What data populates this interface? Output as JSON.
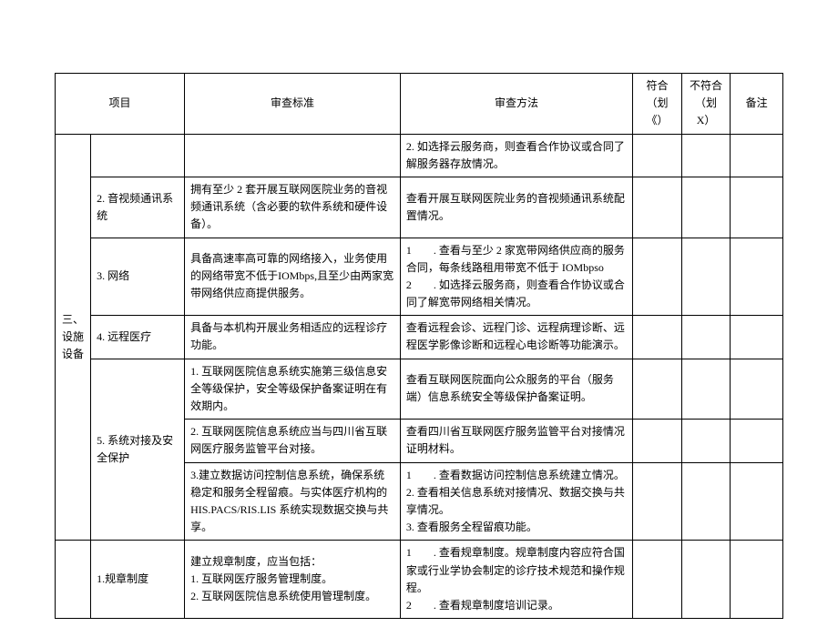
{
  "header": {
    "project": "项目",
    "standard": "审查标准",
    "method": "审查方法",
    "fit": "符合（划《）",
    "nofit": "不符合（划 X）",
    "note": "备注"
  },
  "section": {
    "title": "三、设施设备"
  },
  "rows": [
    {
      "item": "",
      "standard": "",
      "method": "2. 如选择云服务商，则查看合作协议或合同了解服务器存放情况。"
    },
    {
      "item": "2. 音视频通讯系统",
      "standard": "拥有至少 2 套开展互联网医院业务的音视频通讯系统（含必要的软件系统和硬件设备）。",
      "method": "查看开展互联网医院业务的音视频通讯系统配置情况。"
    },
    {
      "item": "3. 网络",
      "standard": "具备高速率高可靠的网络接入，业务使用的网络带宽不低于IOMbps,且至少由两家宽带网络供应商提供服务。",
      "method": "1　　. 查看与至少 2 家宽带网络供应商的服务合同，每条线路租用带宽不低于 IOMbpso\n2　　. 如选择云服务商，则查看合作协议或合同了解宽带网络相关情况。"
    },
    {
      "item": "4. 远程医疗",
      "standard": "具备与本机构开展业务相适应的远程诊疗功能。",
      "method": "查看远程会诊、远程门诊、远程病理诊断、远程医学影像诊断和远程心电诊断等功能演示。"
    },
    {
      "item": "5. 系统对接及安全保护",
      "subrows": [
        {
          "standard": "1. 互联网医院信息系统实施第三级信息安全等级保护，安全等级保护备案证明在有效期内。",
          "method": "查看互联网医院面向公众服务的平台（服务端）信息系统安全等级保护备案证明。"
        },
        {
          "standard": "2. 互联网医院信息系统应当与四川省互联网医疗服务监管平台对接。",
          "method": "查看四川省互联网医疗服务监管平台对接情况证明材料。"
        },
        {
          "standard": "3.建立数据访问控制信息系统，确保系统稳定和服务全程留痕。与实体医疗机构的 HIS.PACS/RIS.LIS 系统实现数据交换与共享。",
          "method": "1　　. 查看数据访问控制信息系统建立情况。\n2. 查看相关信息系统对接情况、数据交换与共享情况。\n3. 查看服务全程留痕功能。"
        }
      ]
    }
  ],
  "extra": {
    "item": "1.规章制度",
    "standard": "建立规章制度，应当包括：\n1. 互联网医疗服务管理制度。\n2. 互联网医院信息系统使用管理制度。",
    "method": "1　　. 查看规章制度。规章制度内容应符合国家或行业学协会制定的诊疗技术规范和操作规程。\n2　　. 查看规章制度培训记录。"
  }
}
